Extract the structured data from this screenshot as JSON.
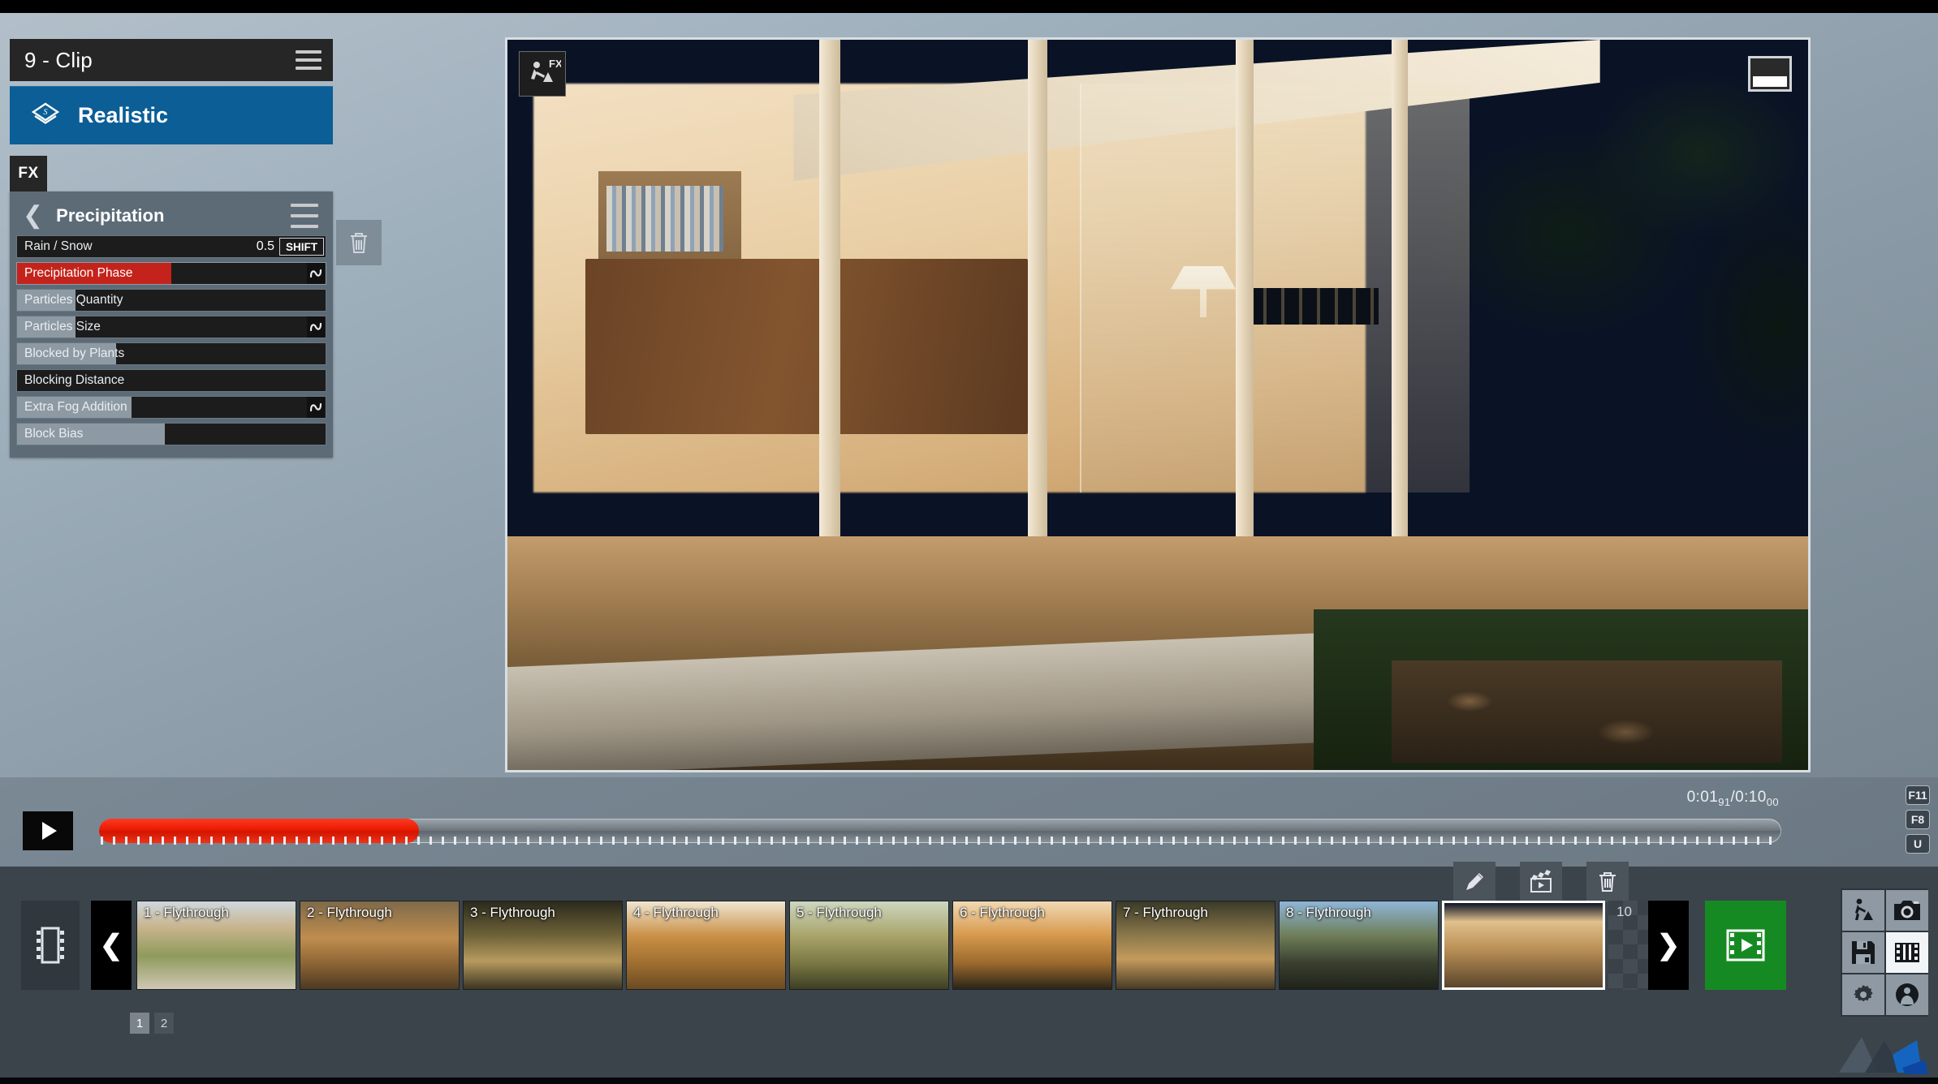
{
  "window": {
    "clip_title": "9 - Clip",
    "menu_icon": "hamburger-icon"
  },
  "style_card": {
    "label": "Realistic",
    "icon": "layers-style-icon"
  },
  "tabs": {
    "fx_label": "FX"
  },
  "effect_panel": {
    "title": "Precipitation",
    "back_icon": "chevron-left-icon",
    "menu_icon": "hamburger-icon",
    "delete_icon": "trash-icon",
    "parameters": [
      {
        "label": "Rain / Snow",
        "fill_pct": 0,
        "value": "0.5",
        "shift_label": "SHIFT",
        "has_wave": false,
        "selected": false
      },
      {
        "label": "Precipitation Phase",
        "fill_pct": 50,
        "value": "",
        "shift_label": "",
        "has_wave": true,
        "selected": true
      },
      {
        "label": "Particles Quantity",
        "fill_pct": 19,
        "value": "",
        "shift_label": "",
        "has_wave": false,
        "selected": false
      },
      {
        "label": "Particles Size",
        "fill_pct": 19,
        "value": "",
        "shift_label": "",
        "has_wave": true,
        "selected": false
      },
      {
        "label": "Blocked by Plants",
        "fill_pct": 32,
        "value": "",
        "shift_label": "",
        "has_wave": false,
        "selected": false
      },
      {
        "label": "Blocking Distance",
        "fill_pct": 0,
        "value": "",
        "shift_label": "",
        "has_wave": false,
        "selected": false
      },
      {
        "label": "Extra Fog Addition",
        "fill_pct": 37,
        "value": "",
        "shift_label": "",
        "has_wave": true,
        "selected": false
      },
      {
        "label": "Block Bias",
        "fill_pct": 48,
        "value": "",
        "shift_label": "",
        "has_wave": false,
        "selected": false
      }
    ]
  },
  "viewport": {
    "fx_badge_label": "FX",
    "fx_badge_icon": "construction-worker-icon",
    "corner_widget_icon": "viewport-layout-icon"
  },
  "timeline": {
    "play_icon": "play-icon",
    "progress_pct": 19,
    "current_time": "0:01",
    "current_time_sub": "91",
    "total_time": "0:10",
    "total_time_sub": "00",
    "separator": "/",
    "shortcuts": [
      "F11",
      "F8",
      "U"
    ]
  },
  "filmstrip": {
    "strip_icon": "filmstrip-icon",
    "prev_icon": "chevron-left-icon",
    "next_icon": "chevron-right-icon",
    "tools": [
      {
        "name": "edit-clip-button",
        "icon": "pencil-icon"
      },
      {
        "name": "preview-clip-button",
        "icon": "clapperboard-icon"
      },
      {
        "name": "delete-clip-button",
        "icon": "trash-icon"
      }
    ],
    "clips": [
      {
        "label": "1 - Flythrough",
        "selected": false
      },
      {
        "label": "2 - Flythrough",
        "selected": false
      },
      {
        "label": "3 - Flythrough",
        "selected": false
      },
      {
        "label": "4 - Flythrough",
        "selected": false
      },
      {
        "label": "5 - Flythrough",
        "selected": false
      },
      {
        "label": "6 - Flythrough",
        "selected": false
      },
      {
        "label": "7 - Flythrough",
        "selected": false
      },
      {
        "label": "8 - Flythrough",
        "selected": false
      },
      {
        "label": "",
        "selected": true
      }
    ],
    "empty_slot_number": "10",
    "render_icon": "render-movie-icon",
    "pages": [
      {
        "label": "1",
        "active": true
      },
      {
        "label": "2",
        "active": false
      }
    ]
  },
  "dock": {
    "items": [
      {
        "name": "build-mode-button",
        "icon": "construction-worker-icon",
        "active": false
      },
      {
        "name": "photo-mode-button",
        "icon": "camera-icon",
        "active": false
      },
      {
        "name": "save-button",
        "icon": "floppy-disk-icon",
        "active": false
      },
      {
        "name": "movie-mode-button",
        "icon": "filmstrip-icon",
        "active": true
      },
      {
        "name": "settings-button",
        "icon": "gear-icon",
        "active": false
      },
      {
        "name": "panorama-button",
        "icon": "person-globe-icon",
        "active": false
      }
    ]
  },
  "colors": {
    "accent_red": "#c4231b",
    "style_blue": "#0b5e96",
    "render_green": "#168a22",
    "panel_grey": "#5d6b77"
  }
}
